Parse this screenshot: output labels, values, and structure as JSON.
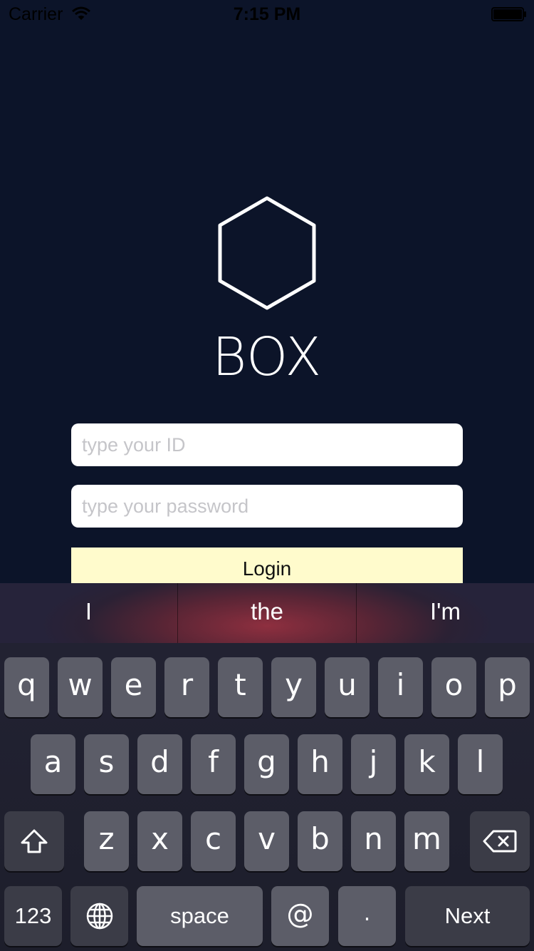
{
  "status_bar": {
    "carrier": "Carrier",
    "time": "7:15 PM"
  },
  "app": {
    "name": "BOX"
  },
  "form": {
    "id_placeholder": "type your ID",
    "password_placeholder": "type your password",
    "login_label": "Login"
  },
  "keyboard": {
    "suggestions": [
      "I",
      "the",
      "I'm"
    ],
    "row1": [
      "q",
      "w",
      "e",
      "r",
      "t",
      "y",
      "u",
      "i",
      "o",
      "p"
    ],
    "row2": [
      "a",
      "s",
      "d",
      "f",
      "g",
      "h",
      "j",
      "k",
      "l"
    ],
    "row3": [
      "z",
      "x",
      "c",
      "v",
      "b",
      "n",
      "m"
    ],
    "numbers_label": "123",
    "space_label": "space",
    "at_label": "@",
    "dot_label": ".",
    "next_label": "Next"
  },
  "icons": [
    "wifi-icon",
    "battery-icon",
    "hexagon-logo-icon",
    "shift-icon",
    "delete-icon",
    "globe-icon"
  ],
  "colors": {
    "background": "#0c1429",
    "login_button": "#fffbcc",
    "key": "#5c5d68",
    "key_dark": "#3b3c47"
  }
}
